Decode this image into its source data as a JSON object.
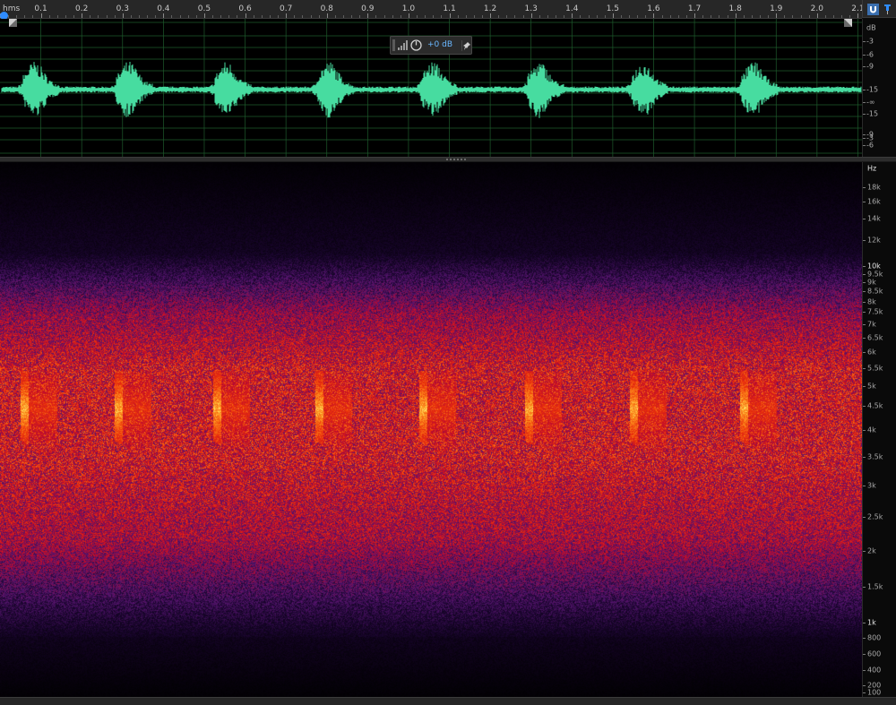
{
  "timeline": {
    "unit_label": "hms",
    "labels": [
      "0.1",
      "0.2",
      "0.3",
      "0.4",
      "0.5",
      "0.6",
      "0.7",
      "0.8",
      "0.9",
      "1.0",
      "1.1",
      "1.2",
      "1.3",
      "1.4",
      "1.5",
      "1.6",
      "1.7",
      "1.8",
      "1.9",
      "2.0",
      "2.1"
    ],
    "start": 0.0,
    "end": 2.11
  },
  "hud": {
    "gain_label": "+0 dB"
  },
  "amplitude_ruler": {
    "unit": "dB",
    "labels": [
      "-3",
      "-6",
      "-9",
      "-15",
      "-∞",
      "-15",
      "-9",
      "-6",
      "-3"
    ]
  },
  "frequency_ruler": {
    "unit": "Hz",
    "labels": [
      "18k",
      "16k",
      "14k",
      "12k",
      "10k",
      "9.5k",
      "9k",
      "8.5k",
      "8k",
      "7.5k",
      "7k",
      "6.5k",
      "6k",
      "5.5k",
      "5k",
      "4.5k",
      "4k",
      "3.5k",
      "3k",
      "2.5k",
      "2k",
      "1.5k",
      "1k",
      "800",
      "600",
      "400",
      "200",
      "100"
    ]
  },
  "calls": [
    0.055,
    0.285,
    0.525,
    0.775,
    1.03,
    1.29,
    1.545,
    1.815
  ],
  "colors": {
    "waveform": "#47dca0",
    "accent": "#2f8cff",
    "grid": "#1e5a2c"
  }
}
